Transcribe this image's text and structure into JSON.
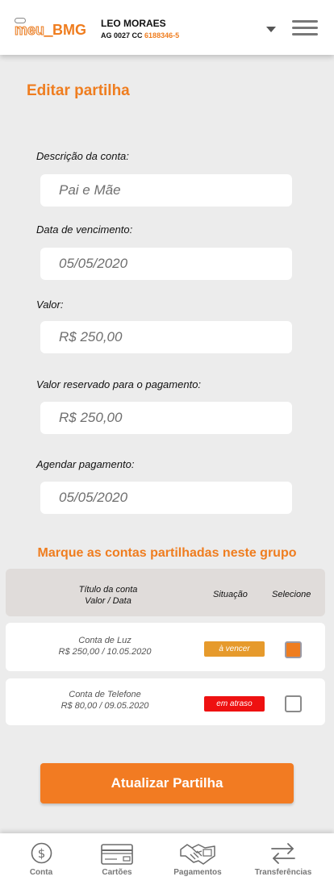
{
  "header": {
    "logo_meu": "meu_",
    "logo_bmg": "BMG",
    "user_name": "LEO MORAES",
    "account_prefix": "AG 0027 CC",
    "account_number": "6188346-5"
  },
  "page": {
    "title": "Editar partilha"
  },
  "form": {
    "description_label": "Descrição da conta:",
    "description_value": "Pai e Mãe",
    "due_date_label": "Data de vencimento:",
    "due_date_value": "05/05/2020",
    "amount_label": "Valor:",
    "amount_value": "R$ 250,00",
    "reserved_label": "Valor reservado para o pagamento:",
    "reserved_value": "R$ 250,00",
    "schedule_label": "Agendar pagamento:",
    "schedule_value": "05/05/2020"
  },
  "group": {
    "title": "Marque as contas partilhadas neste grupo",
    "col_title_1": "Título da conta",
    "col_title_2": "Valor / Data",
    "col_status": "Situação",
    "col_select": "Selecione",
    "rows": [
      {
        "name": "Conta de Luz",
        "value_date": "R$ 250,00 / 10.05.2020",
        "status": "à vencer",
        "status_color": "#e69a2c",
        "selected": true
      },
      {
        "name": "Conta de Telefone",
        "value_date": "R$ 80,00 / 09.05.2020",
        "status": "em atraso",
        "status_color": "#ee1111",
        "selected": false
      }
    ]
  },
  "update_button": "Atualizar Partilha",
  "nav": {
    "items": [
      {
        "label": "Conta",
        "icon": "dollar-circle-icon"
      },
      {
        "label": "Cartões",
        "icon": "credit-card-icon"
      },
      {
        "label": "Pagamentos",
        "icon": "handshake-icon"
      },
      {
        "label": "Transferências",
        "icon": "transfer-arrows-icon"
      }
    ]
  },
  "colors": {
    "accent": "#ef7d1f",
    "background": "#ececec"
  }
}
